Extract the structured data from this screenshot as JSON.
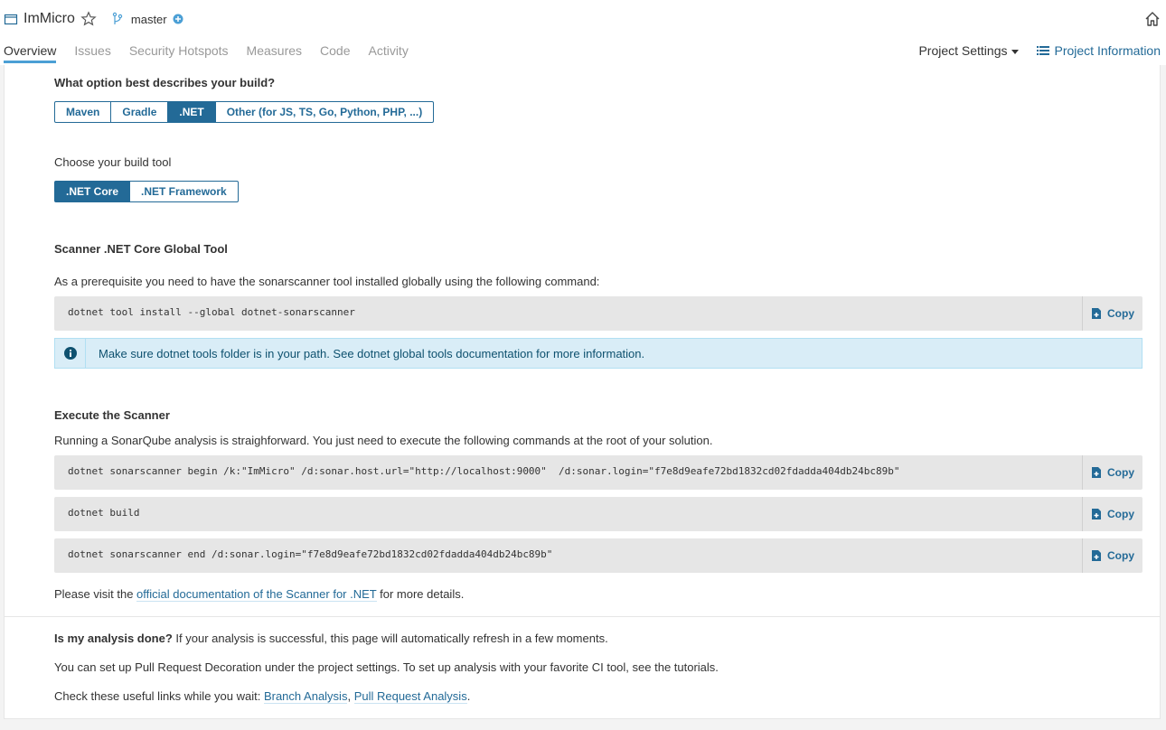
{
  "header": {
    "project_name": "ImMicro",
    "branch": "master"
  },
  "tabs": [
    {
      "label": "Overview"
    },
    {
      "label": "Issues"
    },
    {
      "label": "Security Hotspots"
    },
    {
      "label": "Measures"
    },
    {
      "label": "Code"
    },
    {
      "label": "Activity"
    }
  ],
  "right_nav": {
    "settings": "Project Settings",
    "info": "Project Information"
  },
  "build_question": {
    "title": "What option best describes your build?",
    "options": [
      "Maven",
      "Gradle",
      ".NET",
      "Other (for JS, TS, Go, Python, PHP, ...)"
    ],
    "selected": ".NET"
  },
  "build_tool": {
    "title": "Choose your build tool",
    "options": [
      ".NET Core",
      ".NET Framework"
    ],
    "selected": ".NET Core"
  },
  "global_tool": {
    "title": "Scanner .NET Core Global Tool",
    "desc": "As a prerequisite you need to have the sonarscanner tool installed globally using the following command:",
    "command": "dotnet tool install --global dotnet-sonarscanner",
    "alert": "Make sure dotnet tools folder is in your path. See dotnet global tools documentation for more information."
  },
  "execute": {
    "title": "Execute the Scanner",
    "desc": "Running a SonarQube analysis is straighforward. You just need to execute the following commands at the root of your solution.",
    "commands": [
      "dotnet sonarscanner begin /k:\"ImMicro\" /d:sonar.host.url=\"http://localhost:9000\"  /d:sonar.login=\"f7e8d9eafe72bd1832cd02fdadda404db24bc89b\"",
      "dotnet build",
      "dotnet sonarscanner end /d:sonar.login=\"f7e8d9eafe72bd1832cd02fdadda404db24bc89b\""
    ],
    "copy_label": "Copy",
    "visit_prefix": "Please visit the ",
    "visit_link": "official documentation of the Scanner for .NET",
    "visit_suffix": " for more details."
  },
  "footer": {
    "done_bold": "Is my analysis done?",
    "done_text": " If your analysis is successful, this page will automatically refresh in a few moments.",
    "pr_text": "You can set up Pull Request Decoration under the project settings. To set up analysis with your favorite CI tool, see the tutorials.",
    "links_prefix": "Check these useful links while you wait: ",
    "link1": "Branch Analysis",
    "sep": ", ",
    "link2": "Pull Request Analysis",
    "dot": "."
  },
  "colors": {
    "accent": "#236a97",
    "tab_underline": "#4b9fd5",
    "alert_bg": "#d9edf7"
  }
}
